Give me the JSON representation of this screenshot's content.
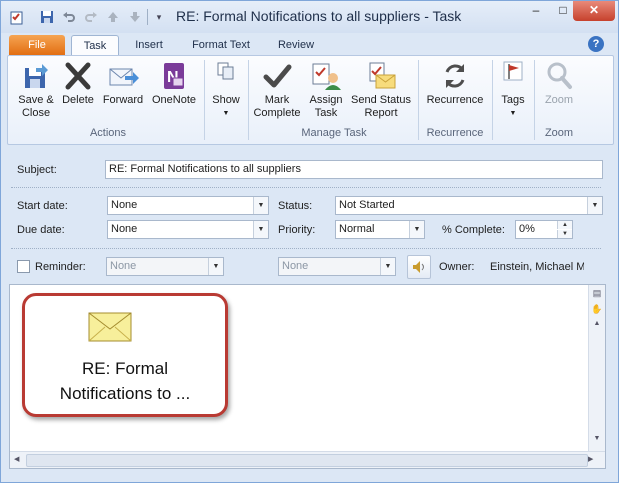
{
  "window": {
    "title": "RE: Formal Notifications to all suppliers  -  Task",
    "controls": {
      "minimize": "–",
      "maximize": "□",
      "close": "✕"
    }
  },
  "tabs": [
    {
      "label": "File"
    },
    {
      "label": "Task"
    },
    {
      "label": "Insert"
    },
    {
      "label": "Format Text"
    },
    {
      "label": "Review"
    }
  ],
  "ribbon": {
    "actions": {
      "group_label": "Actions",
      "save_close": "Save &\nClose",
      "delete": "Delete",
      "forward": "Forward",
      "onenote": "OneNote"
    },
    "show": {
      "label": "Show"
    },
    "manage_task": {
      "group_label": "Manage Task",
      "mark_complete": "Mark\nComplete",
      "assign_task": "Assign\nTask",
      "send_status": "Send Status\nReport"
    },
    "recurrence": {
      "group_label": "Recurrence",
      "label": "Recurrence"
    },
    "tags": {
      "label": "Tags"
    },
    "zoom": {
      "group_label": "Zoom",
      "label": "Zoom"
    }
  },
  "form": {
    "subject_label": "Subject:",
    "subject_value": "RE: Formal Notifications to all suppliers",
    "start_date_label": "Start date:",
    "start_date_value": "None",
    "due_date_label": "Due date:",
    "due_date_value": "None",
    "status_label": "Status:",
    "status_value": "Not Started",
    "priority_label": "Priority:",
    "priority_value": "Normal",
    "percent_label": "% Complete:",
    "percent_value": "0%",
    "reminder_label": "Reminder:",
    "reminder_date": "None",
    "reminder_time": "None",
    "owner_label": "Owner:",
    "owner_value": "Einstein, Michael M"
  },
  "attachment": {
    "caption_line1": "RE: Formal",
    "caption_line2": "Notifications to ..."
  },
  "colors": {
    "accent": "#e26e12",
    "highlight_border": "#b93a33"
  }
}
